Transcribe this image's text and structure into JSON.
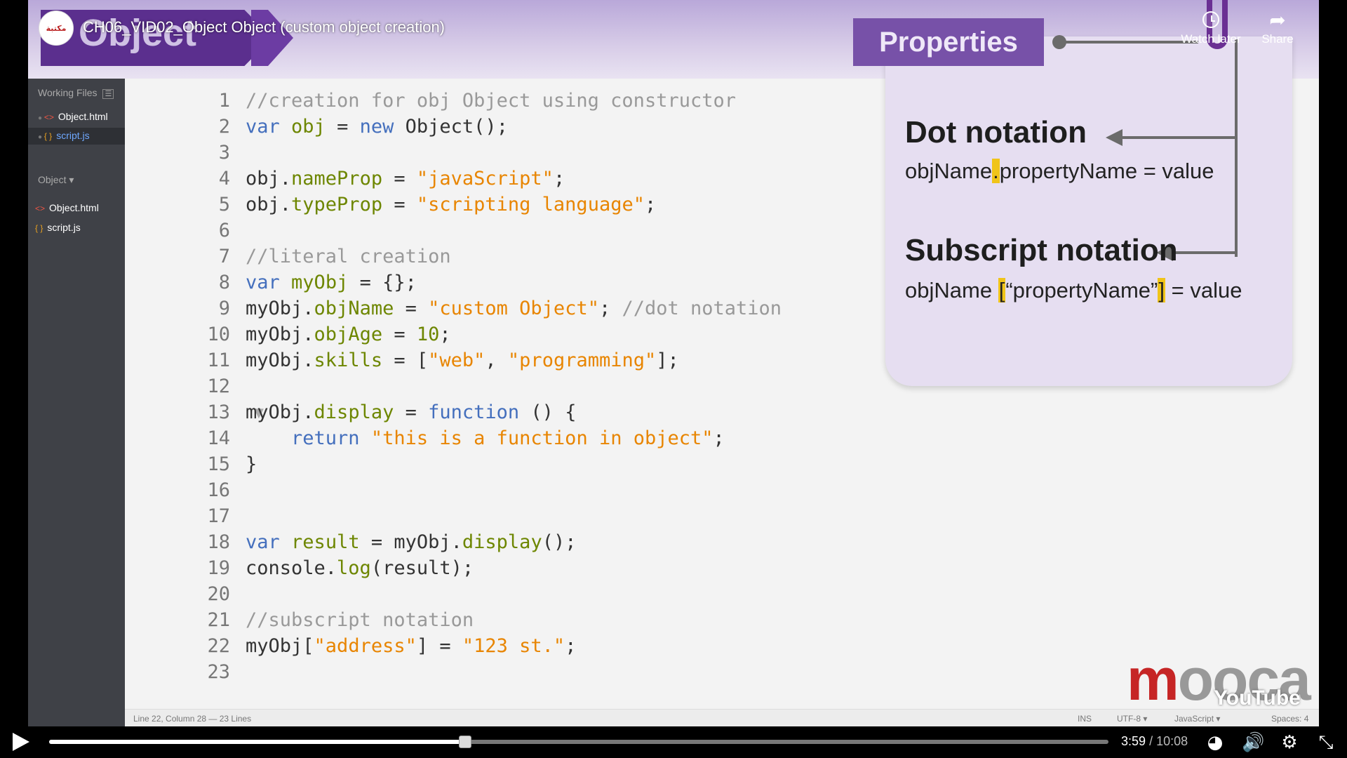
{
  "player": {
    "video_title": "CH06_VID02_Object Object (custom object creation)",
    "channel_badge": "مكتبة",
    "watch_later": "Watch later",
    "share": "Share",
    "current_time": "3:59",
    "duration": "/ 10:08",
    "progress": 0.393
  },
  "slide": {
    "title_word": "Object",
    "properties_label": "Properties",
    "dot_title": "Dot notation",
    "dot_expr_before": "objName",
    "dot_expr_hl": ".",
    "dot_expr_after": "propertyName = value",
    "sub_title": "Subscript notation",
    "sub_expr_before": "objName ",
    "sub_expr_hl1": "[",
    "sub_expr_mid": "“propertyName”",
    "sub_expr_hl2": "]",
    "sub_expr_after": " = value"
  },
  "sidebar": {
    "working_files": "Working Files",
    "files": [
      {
        "icon": "<>",
        "name": "Object.html"
      },
      {
        "icon": "{ }",
        "name": "script.js"
      }
    ],
    "project": "Object ▾",
    "tree": [
      {
        "icon": "<>",
        "name": "Object.html"
      },
      {
        "icon": "{ }",
        "name": "script.js"
      }
    ]
  },
  "code": {
    "numbers": [
      "1",
      "2",
      "3",
      "4",
      "5",
      "6",
      "7",
      "8",
      "9",
      "10",
      "11",
      "12",
      "13",
      "14",
      "15",
      "16",
      "17",
      "18",
      "19",
      "20",
      "21",
      "22",
      "23"
    ]
  },
  "status": {
    "position": "Line 22, Column 28 — 23 Lines",
    "ins": "INS",
    "encoding": "UTF-8 ▾",
    "language": "JavaScript ▾",
    "spaces": "Spaces: 4"
  },
  "watermark": {
    "brand_red": "m",
    "brand_rest": "ooca",
    "youtube": "YouTube"
  },
  "colors": {
    "accent_purple": "#7751a8",
    "highlight": "#f0c419",
    "brand_red": "#c62525"
  }
}
